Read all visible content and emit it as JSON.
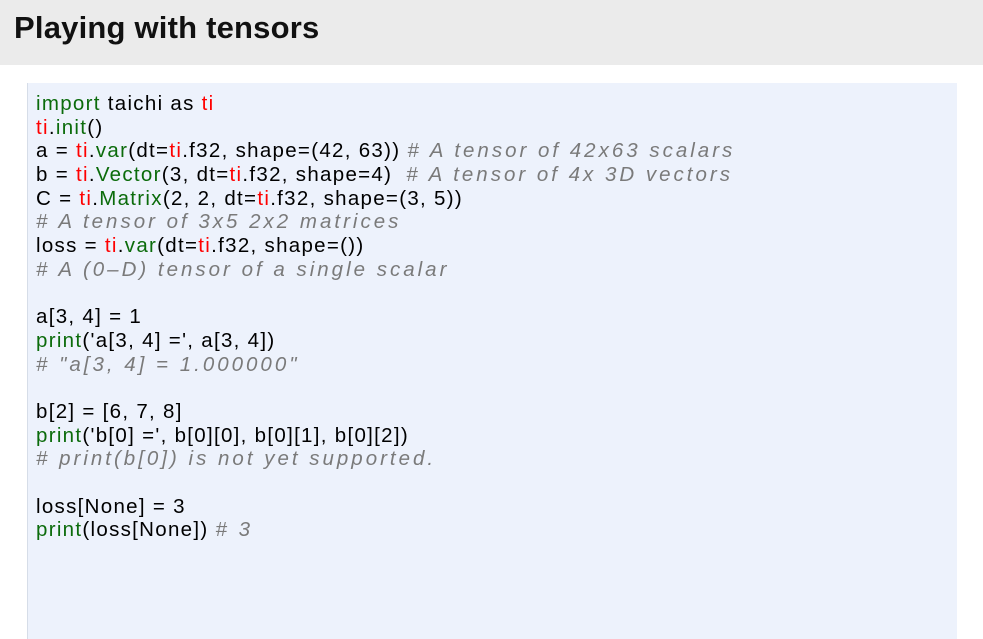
{
  "slide": {
    "title": "Playing with tensors"
  },
  "code": {
    "l1": {
      "a": "import",
      "b": " taichi as ",
      "c": "ti"
    },
    "l2": {
      "a": "ti",
      "b": ".",
      "c": "init",
      "d": "()"
    },
    "l3": {
      "a": "a = ",
      "b": "ti",
      "c": ".",
      "d": "var",
      "e": "(dt=",
      "f": "ti",
      "g": ".f32, shape=(42, 63)) ",
      "h": "# A tensor of 42x63 scalars"
    },
    "l4": {
      "a": "b = ",
      "b": "ti",
      "c": ".",
      "d": "Vector",
      "e": "(3, dt=",
      "f": "ti",
      "g": ".f32, shape=4)  ",
      "h": "# A tensor of 4x 3D vectors"
    },
    "l5": {
      "a": "C = ",
      "b": "ti",
      "c": ".",
      "d": "Matrix",
      "e": "(2, 2, dt=",
      "f": "ti",
      "g": ".f32, shape=(3, 5))"
    },
    "l6": {
      "a": "# A tensor of 3x5 2x2 matrices"
    },
    "l7": {
      "a": "loss = ",
      "b": "ti",
      "c": ".",
      "d": "var",
      "e": "(dt=",
      "f": "ti",
      "g": ".f32, shape=())"
    },
    "l8": {
      "a": "# A (0–D) tensor of a single scalar"
    },
    "l9": {
      "a": ""
    },
    "l10": {
      "a": "a[3, 4] = 1"
    },
    "l11": {
      "a": "print",
      "b": "('a[3, 4] =', a[3, 4])"
    },
    "l12": {
      "a": "# \"a[3, 4] = 1.000000\""
    },
    "l13": {
      "a": ""
    },
    "l14": {
      "a": "b[2] = [6, 7, 8]"
    },
    "l15": {
      "a": "print",
      "b": "('b[0] =', b[0][0], b[0][1], b[0][2])"
    },
    "l16": {
      "a": "# print(b[0]) is not yet supported."
    },
    "l17": {
      "a": ""
    },
    "l18": {
      "a": "loss[None] = 3"
    },
    "l19": {
      "a": "print",
      "b": "(loss[None]) ",
      "c": "# 3"
    }
  }
}
